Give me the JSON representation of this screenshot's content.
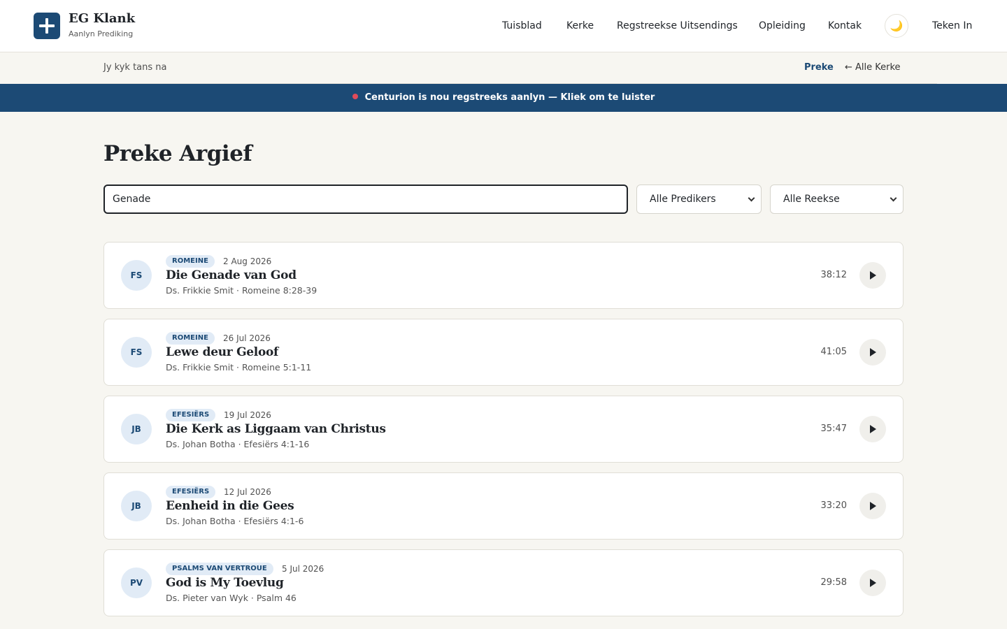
{
  "brand": {
    "name": "EG Klank",
    "subtitle": "Aanlyn Prediking"
  },
  "nav": {
    "items": [
      "Tuisblad",
      "Kerke",
      "Regstreekse Uitsendings",
      "Opleiding",
      "Kontak"
    ],
    "theme_icon": "🌙",
    "sign_in": "Teken In"
  },
  "subbar": {
    "label": "Jy kyk tans na",
    "active": "Preke",
    "back": "← Alle Kerke"
  },
  "live_banner": {
    "text": "Centurion is nou regstreeks aanlyn — Kliek om te luister",
    "dot_color": "#e04b5a"
  },
  "page": {
    "title": "Preke Argief"
  },
  "filters": {
    "search_value": "Genade",
    "preacher": "Alle Predikers",
    "series": "Alle Reekse"
  },
  "sermons": [
    {
      "initials": "FS",
      "series": "ROMEINE",
      "date": "2 Aug 2026",
      "title": "Die Genade van God",
      "preacher": "Ds. Frikkie Smit",
      "passage": "Romeine 8:28-39",
      "meta": "Ds. Frikkie Smit · Romeine 8:28-39",
      "duration": "38:12"
    },
    {
      "initials": "FS",
      "series": "ROMEINE",
      "date": "26 Jul 2026",
      "title": "Lewe deur Geloof",
      "preacher": "Ds. Frikkie Smit",
      "passage": "Romeine 5:1-11",
      "meta": "Ds. Frikkie Smit · Romeine 5:1-11",
      "duration": "41:05"
    },
    {
      "initials": "JB",
      "series": "EFESIËRS",
      "date": "19 Jul 2026",
      "title": "Die Kerk as Liggaam van Christus",
      "preacher": "Ds. Johan Botha",
      "passage": "Efesiërs 4:1-16",
      "meta": "Ds. Johan Botha · Efesiërs 4:1-16",
      "duration": "35:47"
    },
    {
      "initials": "JB",
      "series": "EFESIËRS",
      "date": "12 Jul 2026",
      "title": "Eenheid in die Gees",
      "preacher": "Ds. Johan Botha",
      "passage": "Efesiërs 4:1-6",
      "meta": "Ds. Johan Botha · Efesiërs 4:1-6",
      "duration": "33:20"
    },
    {
      "initials": "PV",
      "series": "PSALMS VAN VERTROUE",
      "date": "5 Jul 2026",
      "title": "God is My Toevlug",
      "preacher": "Ds. Pieter van Wyk",
      "passage": "Psalm 46",
      "meta": "Ds. Pieter van Wyk · Psalm 46",
      "duration": "29:58"
    }
  ],
  "colors": {
    "brand": "#1c4a75",
    "badge_bg": "#e1ebf6",
    "page_bg": "#f7f6f1"
  }
}
